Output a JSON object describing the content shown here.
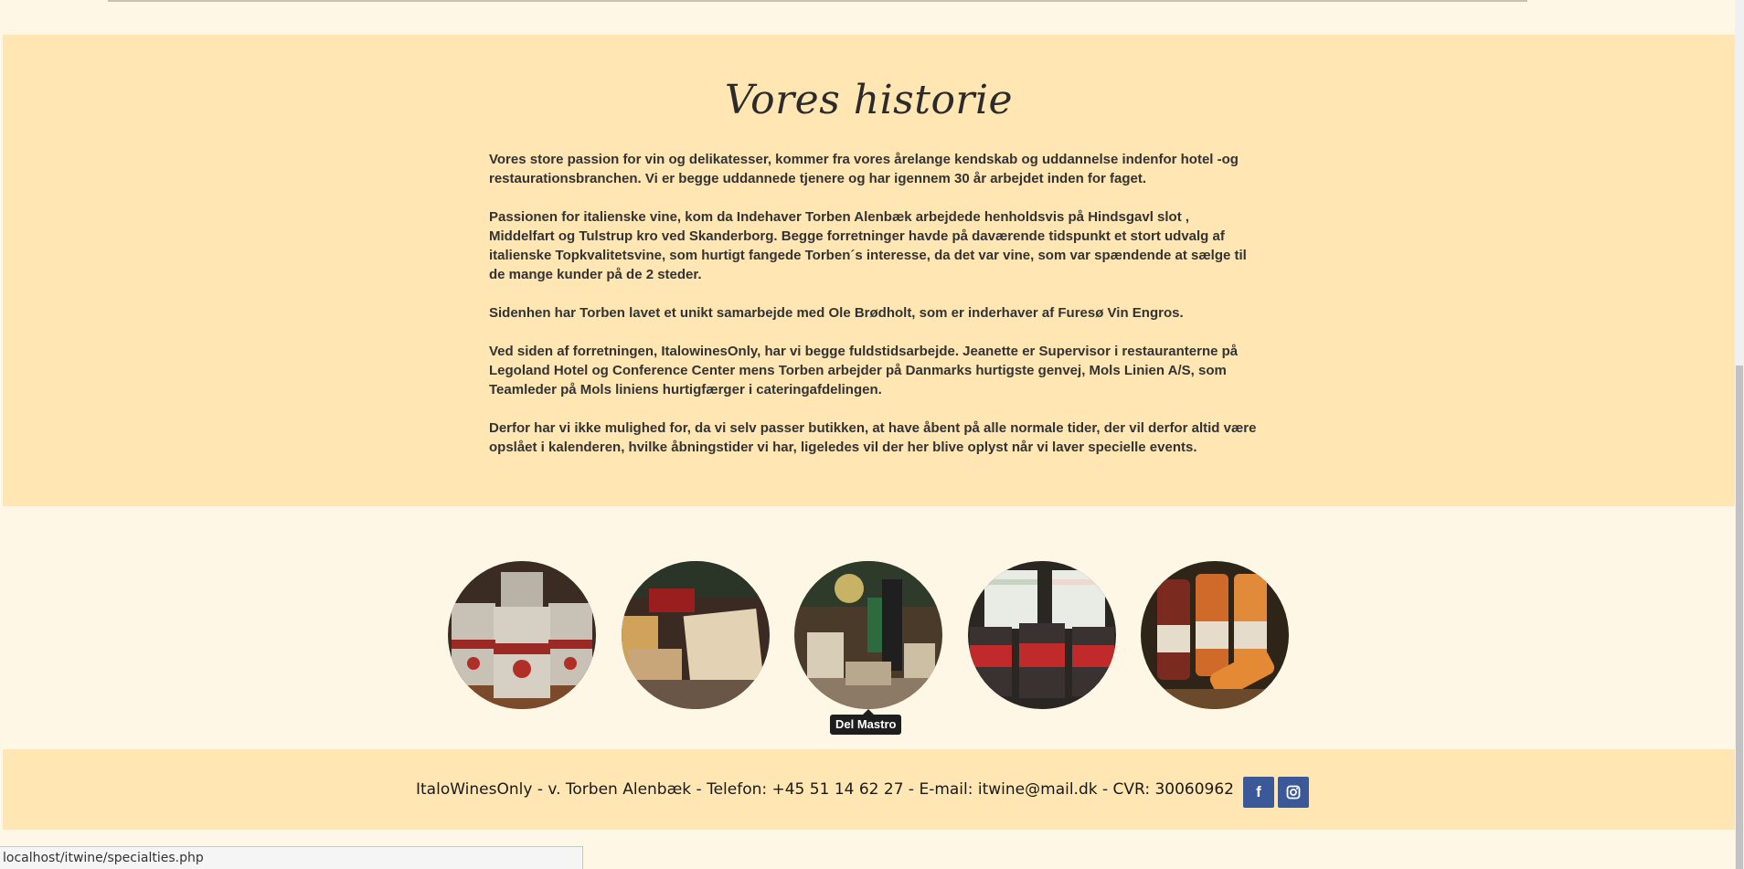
{
  "history": {
    "title": "Vores historie",
    "paragraphs": [
      "Vores store passion for vin og delikatesser, kommer fra vores årelange kendskab og uddannelse indenfor hotel -og restaurationsbranchen. Vi er begge uddannede tjenere og har igennem 30 år arbejdet inden for faget.",
      "Passionen for italienske vine, kom da Indehaver Torben Alenbæk arbejdede henholdsvis på Hindsgavl slot , Middelfart og Tulstrup kro ved Skanderborg. Begge forretninger havde på daværende tidspunkt et stort udvalg af italienske Topkvalitetsvine, som hurtigt fangede Torben´s interesse, da det var vine, som var spændende at sælge til de mange kunder på de 2 steder.",
      "Sidenhen har Torben lavet et unikt samarbejde med Ole Brødholt, som er inderhaver af Furesø Vin Engros.",
      "Ved siden af forretningen, ItalowinesOnly, har vi begge fuldstidsarbejde. Jeanette er Supervisor i restauranterne på Legoland Hotel og Conference Center mens Torben arbejder på Danmarks hurtigste genvej, Mols Linien A/S, som Teamleder på Mols liniens hurtigfærger i cateringafdelingen.",
      "Derfor har vi ikke mulighed for, da vi selv passer butikken, at have åbent på alle normale tider, der vil derfor altid være opslået i kalenderen, hvilke åbningstider vi har, ligeledes vil der her blive oplyst når vi laver specielle events."
    ]
  },
  "gallery": {
    "items": [
      {
        "name": "chaplon-tea-tins"
      },
      {
        "name": "lartisan-chocolate"
      },
      {
        "name": "del-mastro"
      },
      {
        "name": "karameller-slikkepinde-jars"
      },
      {
        "name": "juice-bottles"
      }
    ],
    "tooltip": "Del Mastro"
  },
  "footer": {
    "info": "ItaloWinesOnly - v. Torben Alenbæk - Telefon: +45 51 14 62 27 - E-mail: itwine@mail.dk - CVR: 30060962",
    "social": [
      {
        "icon": "facebook-icon",
        "glyph": "f"
      },
      {
        "icon": "instagram-icon"
      }
    ]
  },
  "status_bar": {
    "url": "localhost/itwine/specialties.php"
  },
  "colors": {
    "page_bg": "#fff7e6",
    "section_bg": "#ffe6b3",
    "social_bg": "#3b5998",
    "tooltip_bg": "#1e1e1e"
  }
}
